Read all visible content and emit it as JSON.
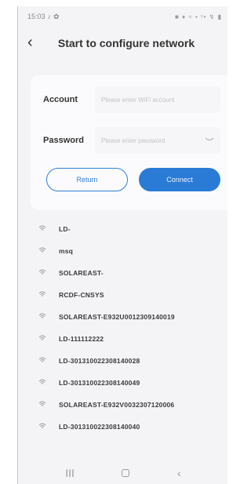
{
  "status_bar": {
    "time": "15:03",
    "icons": "■ ♦ ≈ ▪ ᵞ▪ ↯ ▮"
  },
  "header": {
    "back_icon": "‹",
    "title": "Start to configure network"
  },
  "form": {
    "account_label": "Account",
    "account_placeholder": "Please enter WiFi account",
    "password_label": "Password",
    "password_placeholder": "Please enter password"
  },
  "buttons": {
    "return_label": "Return",
    "connect_label": "Connect"
  },
  "wifi_list": [
    {
      "name": "LD-"
    },
    {
      "name": "msq"
    },
    {
      "name": "SOLAREAST-"
    },
    {
      "name": "RCDF-CNSYS"
    },
    {
      "name": "SOLAREAST-E932U0012309140019"
    },
    {
      "name": "LD-111112222"
    },
    {
      "name": "LD-301310022308140028"
    },
    {
      "name": "LD-301310022308140049"
    },
    {
      "name": "SOLAREAST-E932V0032307120006"
    },
    {
      "name": "LD-301310022308140040"
    }
  ],
  "nav": {
    "recents": "III",
    "back": "‹"
  },
  "colors": {
    "accent": "#2a7bd6",
    "background": "#f4f4f6"
  },
  "icons": {
    "wifi": "wifi-icon",
    "eye": "eye-closed-icon",
    "back": "back-arrow-icon"
  }
}
